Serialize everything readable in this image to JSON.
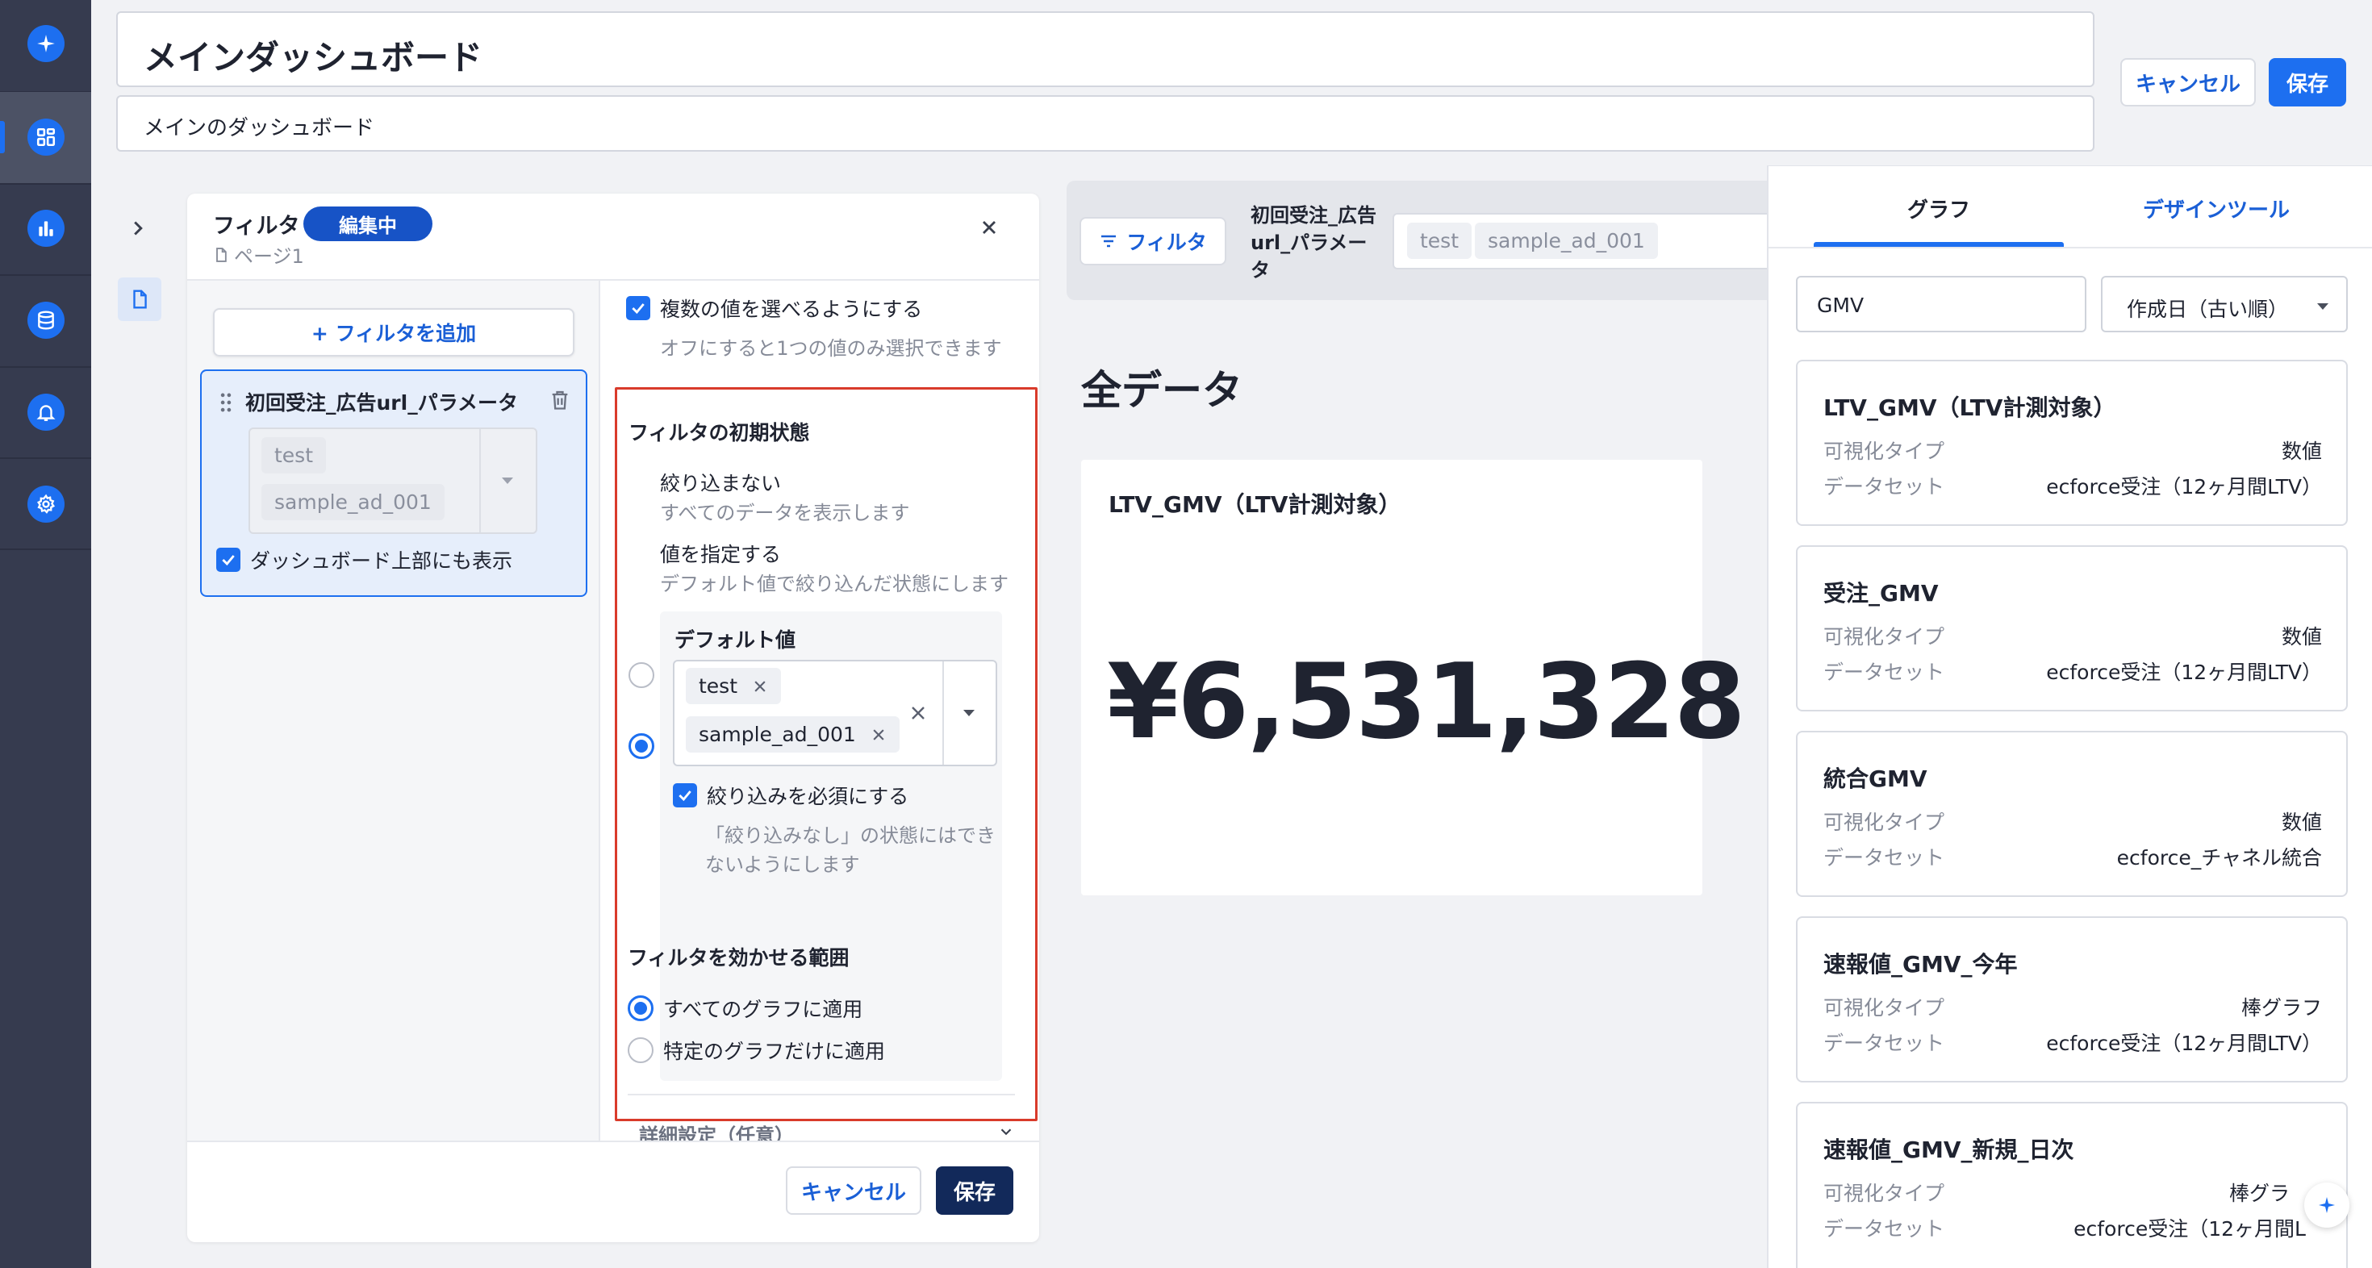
{
  "header": {
    "title": "メインダッシュボード",
    "description": "メインのダッシュボード",
    "cancel_label": "キャンセル",
    "save_label": "保存"
  },
  "filter_panel": {
    "title": "フィルタ",
    "editing_badge": "編集中",
    "page_label": "ページ1",
    "add_filter_label": "+ フィルタを追加",
    "filter_item": {
      "name": "初回受注_広告url_パラメータ",
      "values": [
        "test",
        "sample_ad_001"
      ],
      "show_on_top_label": "ダッシュボード上部にも表示"
    },
    "multi_select_label": "複数の値を選べるようにする",
    "multi_select_desc": "オフにすると1つの値のみ選択できます",
    "initial_state": {
      "heading": "フィルタの初期状態",
      "option_none_label": "絞り込まない",
      "option_none_desc": "すべてのデータを表示します",
      "option_value_label": "値を指定する",
      "option_value_desc": "デフォルト値で絞り込んだ状態にします",
      "default_value_heading": "デフォルト値",
      "default_values": [
        "test",
        "sample_ad_001"
      ],
      "required_label": "絞り込みを必須にする",
      "required_desc_1": "「絞り込みなし」の状態にはでき",
      "required_desc_2": "ないようにします"
    },
    "scope": {
      "heading": "フィルタを効かせる範囲",
      "option_all": "すべてのグラフに適用",
      "option_specific": "特定のグラフだけに適用"
    },
    "advanced_label": "詳細設定（任意）",
    "cancel_label": "キャンセル",
    "save_label": "保存"
  },
  "preview": {
    "filter_button": "フィルタ",
    "filter_name_1": "初回受注_広告",
    "filter_name_2": "url_パラメー",
    "filter_name_3": "タ",
    "filter_values": [
      "test",
      "sample_ad_001"
    ],
    "section_title": "全データ",
    "kpi_title": "LTV_GMV（LTV計測対象）",
    "kpi_value": "¥6,531,328"
  },
  "right_panel": {
    "tabs": [
      "グラフ",
      "デザインツール"
    ],
    "active_tab": "グラフ",
    "search_value": "GMV",
    "sort_value": "作成日（古い順）",
    "label_vis_type": "可視化タイプ",
    "label_dataset": "データセット",
    "cards": [
      {
        "title": "LTV_GMV（LTV計測対象）",
        "vis_type": "数値",
        "dataset": "ecforce受注（12ヶ月間LTV）"
      },
      {
        "title": "受注_GMV",
        "vis_type": "数値",
        "dataset": "ecforce受注（12ヶ月間LTV）"
      },
      {
        "title": "統合GMV",
        "vis_type": "数値",
        "dataset": "ecforce_チャネル統合"
      },
      {
        "title": "速報値_GMV_今年",
        "vis_type": "棒グラフ",
        "dataset": "ecforce受注（12ヶ月間LTV）"
      },
      {
        "title": "速報値_GMV_新規_日次",
        "vis_type": "棒グラ",
        "dataset": "ecforce受注（12ヶ月間L"
      }
    ]
  },
  "colors": {
    "accent": "#1d6ff0",
    "sidebar": "#363b4f",
    "highlight_border": "#d93b2b",
    "save_dark": "#12295a"
  },
  "icons": [
    "sparkle-icon",
    "dashboard-icon",
    "bar-chart-icon",
    "database-icon",
    "bell-icon",
    "gear-icon",
    "chevron-right-icon",
    "page-icon",
    "close-icon",
    "drag-handle-icon",
    "trash-icon",
    "check-icon",
    "chevron-down-icon",
    "filter-icon"
  ]
}
